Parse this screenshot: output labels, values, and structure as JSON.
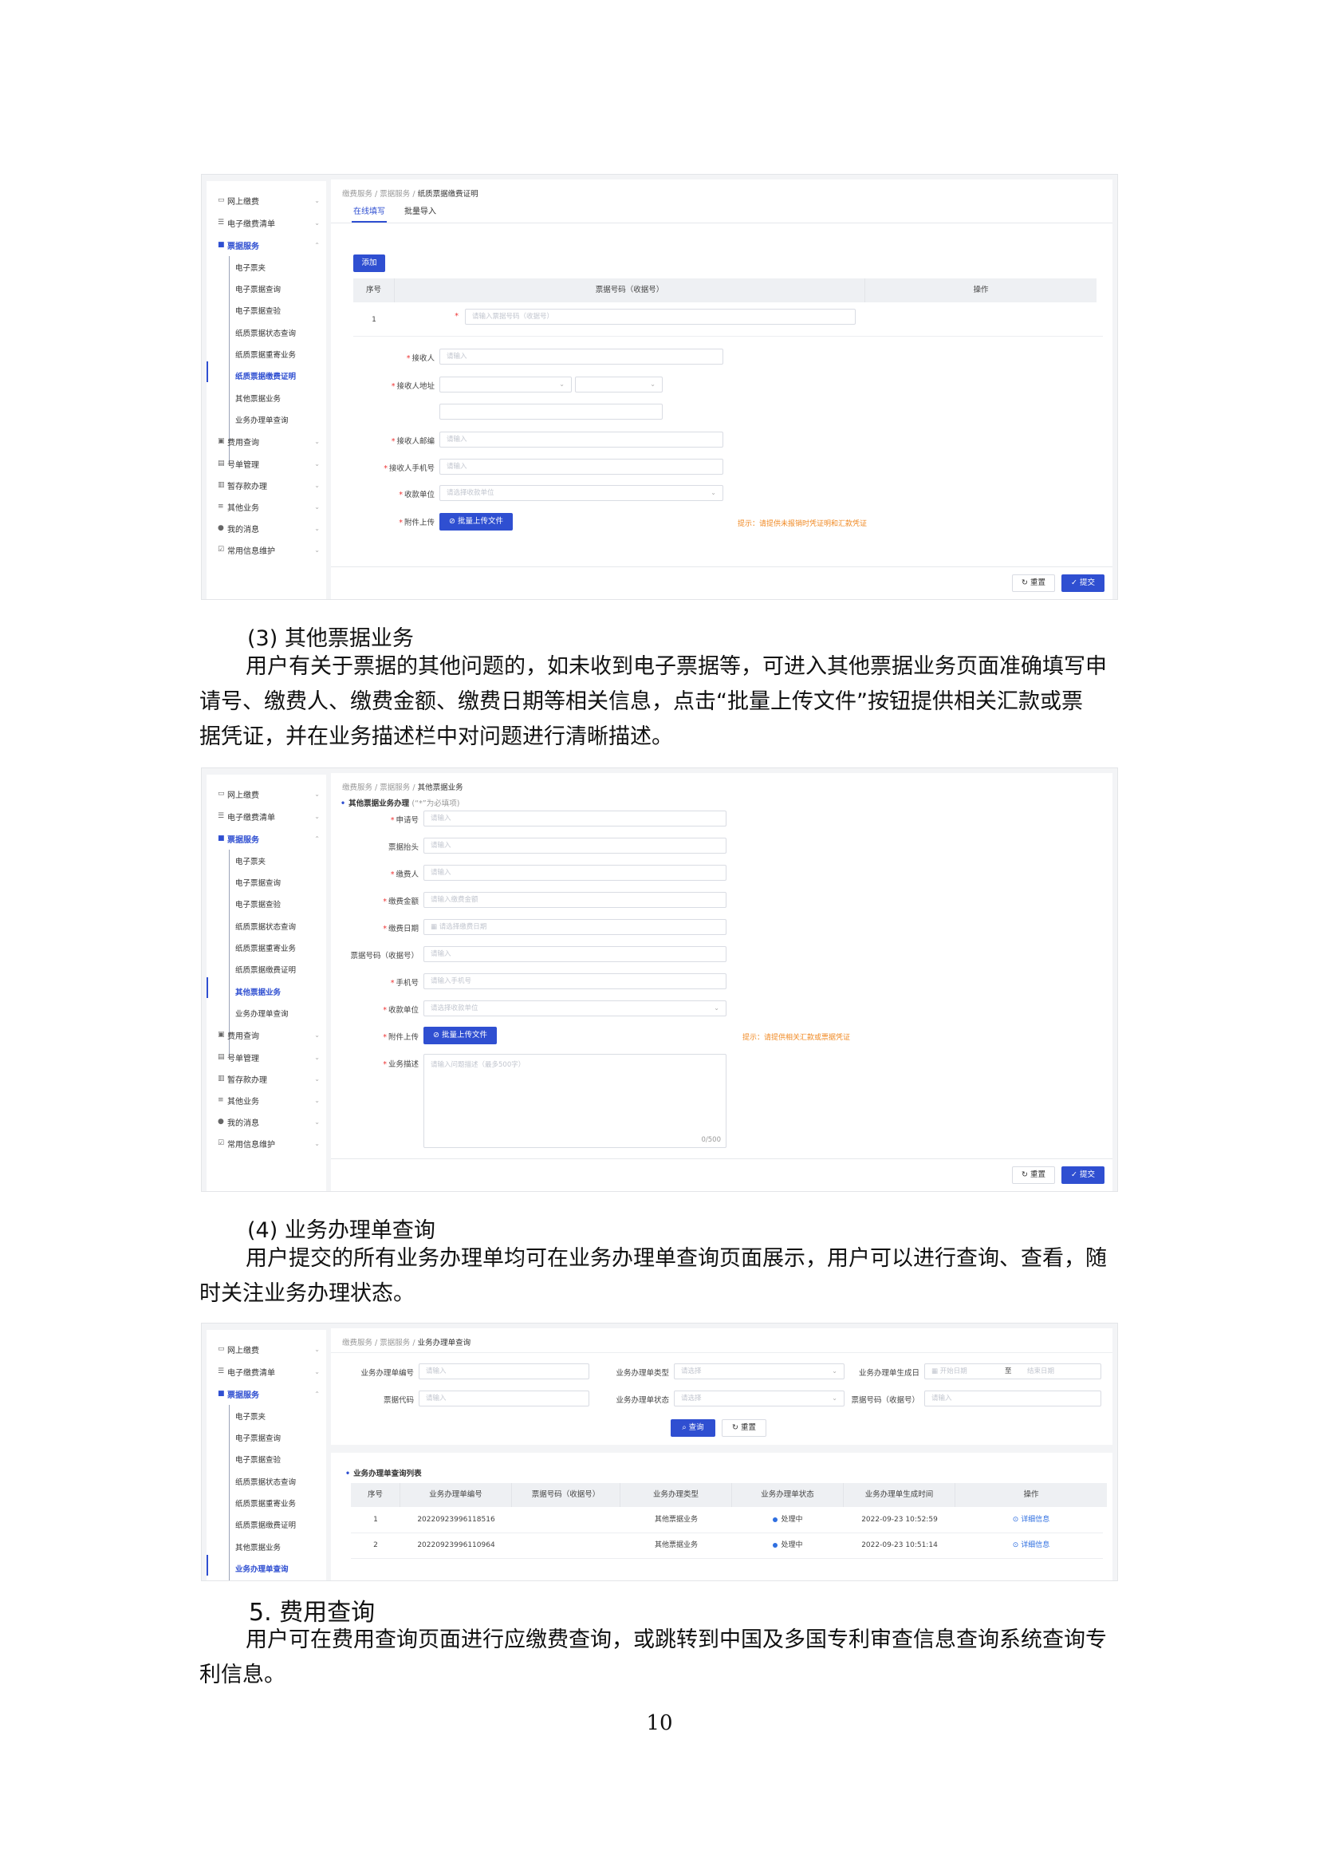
{
  "page_number": "10",
  "sections": [
    {
      "heading": "(3) 其他票据业务",
      "lines": [
        "用户有关于票据的其他问题的，如未收到电子票据等，可进入其他票据业务页面准确填写申",
        "请号、缴费人、缴费金额、缴费日期等相关信息，点击“批量上传文件”按钮提供相关汇款或票",
        "据凭证，并在业务描述栏中对问题进行清晰描述。"
      ]
    },
    {
      "heading": "(4) 业务办理单查询",
      "lines": [
        "用户提交的所有业务办理单均可在业务办理单查询页面展示，用户可以进行查询、查看，随",
        "时关注业务办理状态。"
      ]
    },
    {
      "heading": "5. 费用查询",
      "lines": [
        "用户可在费用查询页面进行应缴费查询，或跳转到中国及多国专利审查信息查询系统查询专",
        "利信息。"
      ]
    }
  ],
  "nav": {
    "top": [
      "网上缴费",
      "电子缴费清单",
      "票据服务"
    ],
    "sub": [
      "电子票夹",
      "电子票据查询",
      "电子票据查验",
      "纸质票据状态查询",
      "纸质票据重寄业务",
      "纸质票据缴费证明",
      "其他票据业务",
      "业务办理单查询"
    ],
    "bottom": [
      "费用查询",
      "号单管理",
      "暂存款办理",
      "其他业务",
      "我的消息",
      "常用信息维护"
    ]
  },
  "shot1": {
    "crumb": {
      "a": "缴费服务",
      "b": "票据服务",
      "c": "纸质票据缴费证明",
      "sep": "/"
    },
    "tabs": [
      "在线填写",
      "批量导入"
    ],
    "add_button": "添加",
    "table_headers": [
      "序号",
      "票据号码（收据号）",
      "操作"
    ],
    "row_index": "1",
    "row_placeholder": "请输入票据号码（收据号）",
    "fields": [
      {
        "label": "接收人",
        "placeholder": "请输入"
      },
      {
        "label": "接收人地址",
        "placeholder": ""
      },
      {
        "label": "接收人邮编",
        "placeholder": "请输入"
      },
      {
        "label": "接收人手机号",
        "placeholder": "请输入"
      },
      {
        "label": "收款单位",
        "placeholder": "请选择收款单位"
      },
      {
        "label": "附件上传",
        "placeholder": ""
      }
    ],
    "upload_button": "批量上传文件",
    "hint": "提示：请提供未报销时凭证明和汇款凭证",
    "reset": "重置",
    "submit": "提交"
  },
  "shot2": {
    "crumb": {
      "a": "缴费服务",
      "b": "票据服务",
      "c": "其他票据业务",
      "sep": "/"
    },
    "section_title": "其他票据业务办理",
    "section_note": "(“*”为必填项)",
    "fields": [
      {
        "label": "申请号",
        "placeholder": "请输入",
        "req": "*"
      },
      {
        "label": "票据抬头",
        "placeholder": "请输入",
        "req": ""
      },
      {
        "label": "缴费人",
        "placeholder": "请输入",
        "req": "*"
      },
      {
        "label": "缴费金额",
        "placeholder": "请输入缴费金额",
        "req": "*"
      },
      {
        "label": "缴费日期",
        "placeholder": "请选择缴费日期",
        "req": "*"
      },
      {
        "label": "票据号码（收据号）",
        "placeholder": "请输入",
        "req": ""
      },
      {
        "label": "手机号",
        "placeholder": "请输入手机号",
        "req": "*"
      },
      {
        "label": "收款单位",
        "placeholder": "请选择收款单位",
        "req": "*"
      },
      {
        "label": "附件上传",
        "placeholder": "",
        "req": "*"
      },
      {
        "label": "业务描述",
        "placeholder": "请输入问题描述（最多500字）",
        "req": "*"
      }
    ],
    "upload_button": "批量上传文件",
    "hint": "提示：请提供相关汇款或票据凭证",
    "counter": "0/500",
    "reset": "重置",
    "submit": "提交"
  },
  "shot3": {
    "crumb": {
      "a": "缴费服务",
      "b": "票据服务",
      "c": "业务办理单查询",
      "sep": "/"
    },
    "filters": [
      {
        "label": "业务办理单编号",
        "placeholder": "请输入"
      },
      {
        "label": "业务办理单类型",
        "placeholder": "请选择"
      },
      {
        "label": "业务办理单生成日",
        "placeholder": "开始日期"
      },
      {
        "label": "票据代码",
        "placeholder": "请输入"
      },
      {
        "label": "业务办理单状态",
        "placeholder": "请选择"
      },
      {
        "label": "票据号码（收据号）",
        "placeholder": "请输入"
      }
    ],
    "date_to": "至",
    "date_end": "结束日期",
    "query_button": "查询",
    "reset_button": "重置",
    "list_title": "业务办理单查询列表",
    "headers": [
      "序号",
      "业务办理单编号",
      "票据号码（收据号）",
      "业务办理类型",
      "业务办理单状态",
      "业务办理单生成时间",
      "操作"
    ],
    "rows": [
      {
        "idx": "1",
        "no": "20220923996118516",
        "receipt": "",
        "type": "其他票据业务",
        "status": "处理中",
        "time": "2022-09-23 10:52:59",
        "op": "详细信息"
      },
      {
        "idx": "2",
        "no": "20220923996110964",
        "receipt": "",
        "type": "其他票据业务",
        "status": "处理中",
        "time": "2022-09-23 10:51:14",
        "op": "详细信息"
      }
    ]
  }
}
